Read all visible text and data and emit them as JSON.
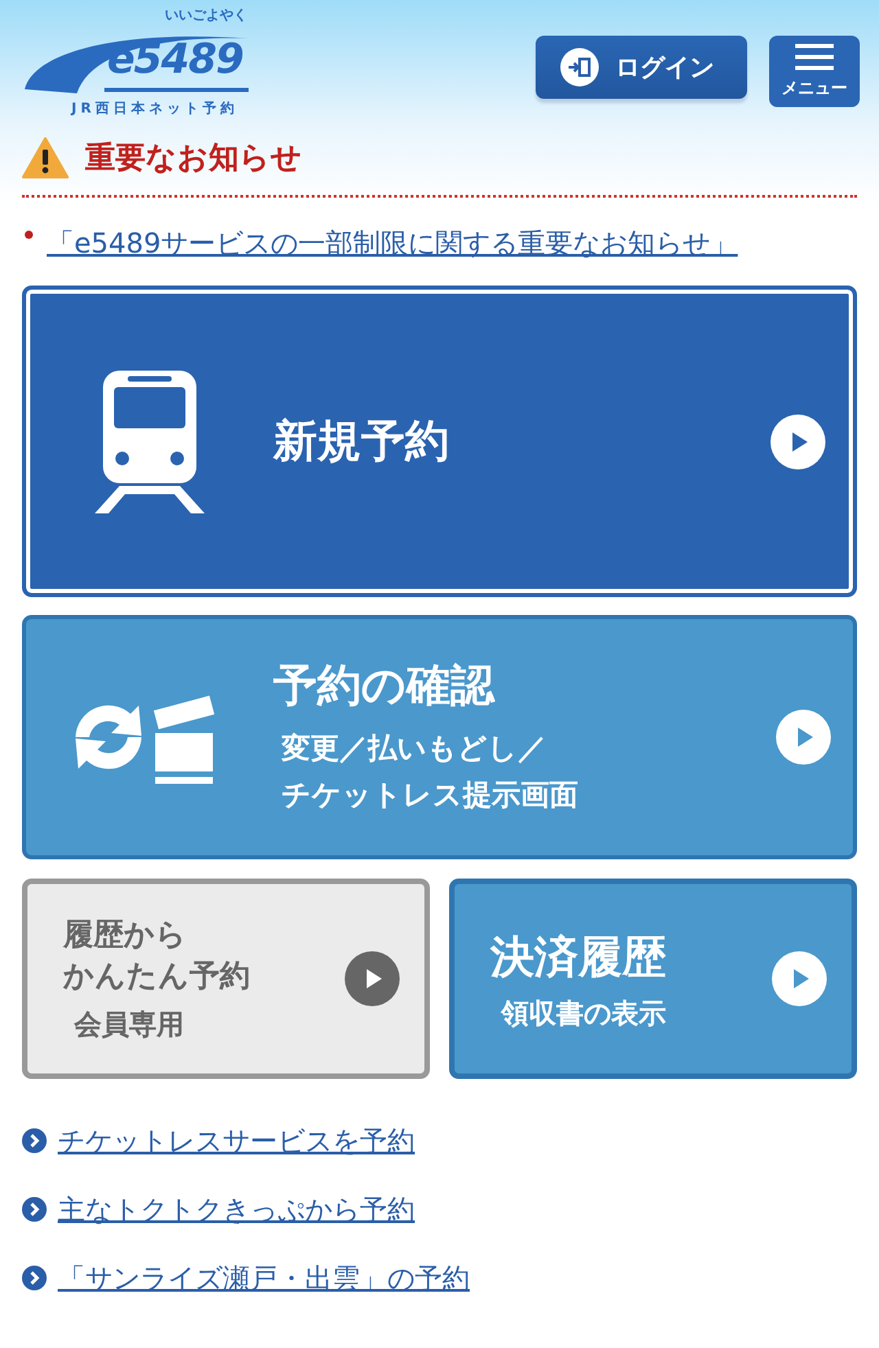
{
  "header": {
    "logo": {
      "ruby": "いいごよやく",
      "name": "e5489",
      "tagline": "JR西日本ネット予約"
    },
    "login_button": "ログイン",
    "menu_button": "メニュー"
  },
  "notice": {
    "title": "重要なお知らせ",
    "items": [
      "「e5489サービスの一部制限に関する重要なお知らせ」"
    ]
  },
  "tiles": [
    {
      "kind": "large",
      "title": "新規予約",
      "disabled": false
    },
    {
      "kind": "wide",
      "title": "予約の確認",
      "lines": [
        "変更／払いもどし／",
        "チケットレス提示画面"
      ],
      "disabled": false
    }
  ],
  "small_tiles": [
    {
      "title_lines": [
        "履歴から",
        "かんたん予約"
      ],
      "subtitle": "会員専用",
      "disabled": true
    },
    {
      "title_lines": [
        "決済履歴"
      ],
      "subtitle": "領収書の表示",
      "disabled": false
    }
  ],
  "links": [
    "チケットレスサービスを予約",
    "主なトクトクきっぷから予約",
    "「サンライズ瀬戸・出雲」の予約"
  ]
}
